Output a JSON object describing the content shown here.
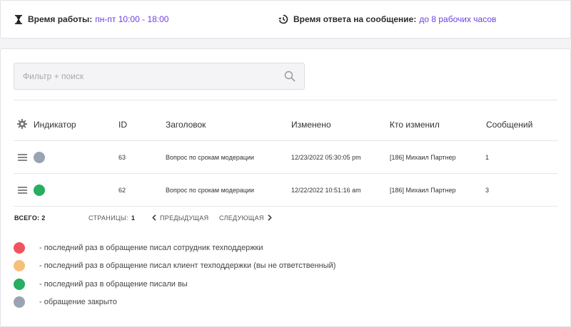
{
  "header": {
    "work_hours_label": "Время работы:",
    "work_hours_value": "пн-пт 10:00 - 18:00",
    "response_label": "Время ответа на сообщение:",
    "response_value": "до 8 рабочих часов",
    "accent_color": "#6f3fe0"
  },
  "search": {
    "placeholder": "Фильтр + поиск",
    "value": ""
  },
  "table": {
    "columns": [
      "Индикатор",
      "ID",
      "Заголовок",
      "Изменено",
      "Кто изменил",
      "Сообщений"
    ],
    "rows": [
      {
        "indicator_color": "#9aa3b2",
        "id": "63",
        "title": "Вопрос по срокам модерации",
        "modified": "12/23/2022 05:30:05 pm",
        "modified_by": "[186] Михаил Партнер",
        "messages": "1"
      },
      {
        "indicator_color": "#27ae60",
        "id": "62",
        "title": "Вопрос по срокам модерации",
        "modified": "12/22/2022 10:51:16 am",
        "modified_by": "[186] Михаил Партнер",
        "messages": "3"
      }
    ]
  },
  "pagination": {
    "total_label": "ВСЕГО: 2",
    "pages_label": "СТРАНИЦЫ:",
    "page_number": "1",
    "prev_label": "ПРЕДЫДУЩАЯ",
    "next_label": "СЛЕДУЮЩАЯ"
  },
  "legend": [
    {
      "color": "#f0555f",
      "text": "- последний раз в обращение писал сотрудник техподдержки"
    },
    {
      "color": "#f5c07a",
      "text": "- последний раз в обращение писал клиент техподдержки (вы не ответственный)"
    },
    {
      "color": "#27ae60",
      "text": "- последний раз в обращение писали вы"
    },
    {
      "color": "#9aa3b2",
      "text": "- обращение закрыто"
    }
  ]
}
